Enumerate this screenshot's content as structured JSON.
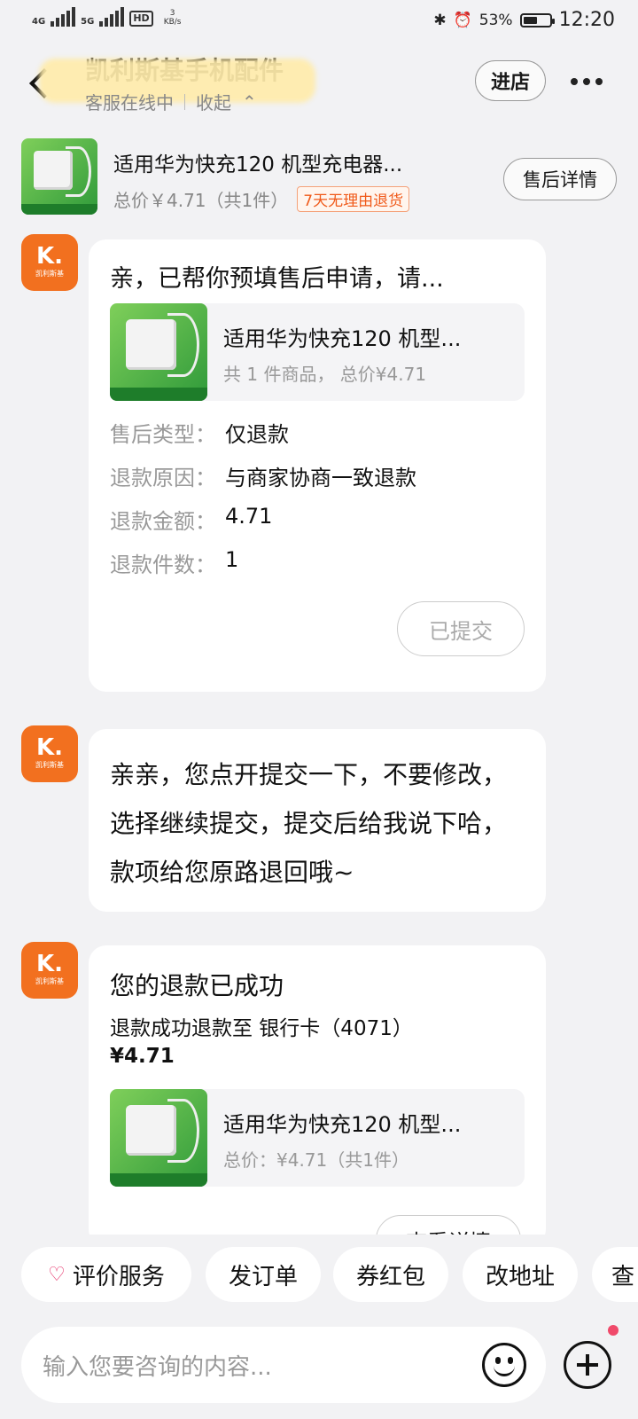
{
  "status": {
    "network": "4G",
    "network2": "5G",
    "hd": "HD",
    "speed_value": "3",
    "speed_unit": "KB/s",
    "battery": "53%",
    "battery_level": 0.53,
    "time": "12:20"
  },
  "header": {
    "shop_name": "凯利斯基手机配件",
    "status": "客服在线中",
    "collapse": "收起",
    "enter_button": "进店"
  },
  "product": {
    "title": "适用华为快充120 机型充电器...",
    "price": "总价￥4.71（共1件）",
    "tag": "7天无理由退货",
    "after_sale_button": "售后详情"
  },
  "messages": {
    "m1": {
      "avatar_letter": "K.",
      "avatar_sub": "凯利斯基",
      "title": "亲，已帮你预填售后申请，请...",
      "card_title": "适用华为快充120 机型...",
      "card_sub": "共 1 件商品， 总价¥4.71",
      "fields": [
        {
          "key": "售后类型：",
          "value": "仅退款"
        },
        {
          "key": "退款原因：",
          "value": "与商家协商一致退款"
        },
        {
          "key": "退款金额：",
          "value": "4.71"
        },
        {
          "key": "退款件数：",
          "value": "1"
        }
      ],
      "submitted_button": "已提交"
    },
    "m2": {
      "avatar_letter": "K.",
      "avatar_sub": "凯利斯基",
      "text": "亲亲，您点开提交一下，不要修改，选择继续提交，提交后给我说下哈，款项给您原路退回哦~"
    },
    "m3": {
      "avatar_letter": "K.",
      "avatar_sub": "凯利斯基",
      "title": "您的退款已成功",
      "line1": "退款成功退款至 银行卡（4071）",
      "amount": "¥4.71",
      "card_title": "适用华为快充120 机型...",
      "card_sub": "总价：¥4.71（共1件）",
      "view_button": "查看详情"
    }
  },
  "quick_actions": [
    "评价服务",
    "发订单",
    "券红包",
    "改地址",
    "查"
  ],
  "input": {
    "placeholder": "输入您要咨询的内容..."
  }
}
